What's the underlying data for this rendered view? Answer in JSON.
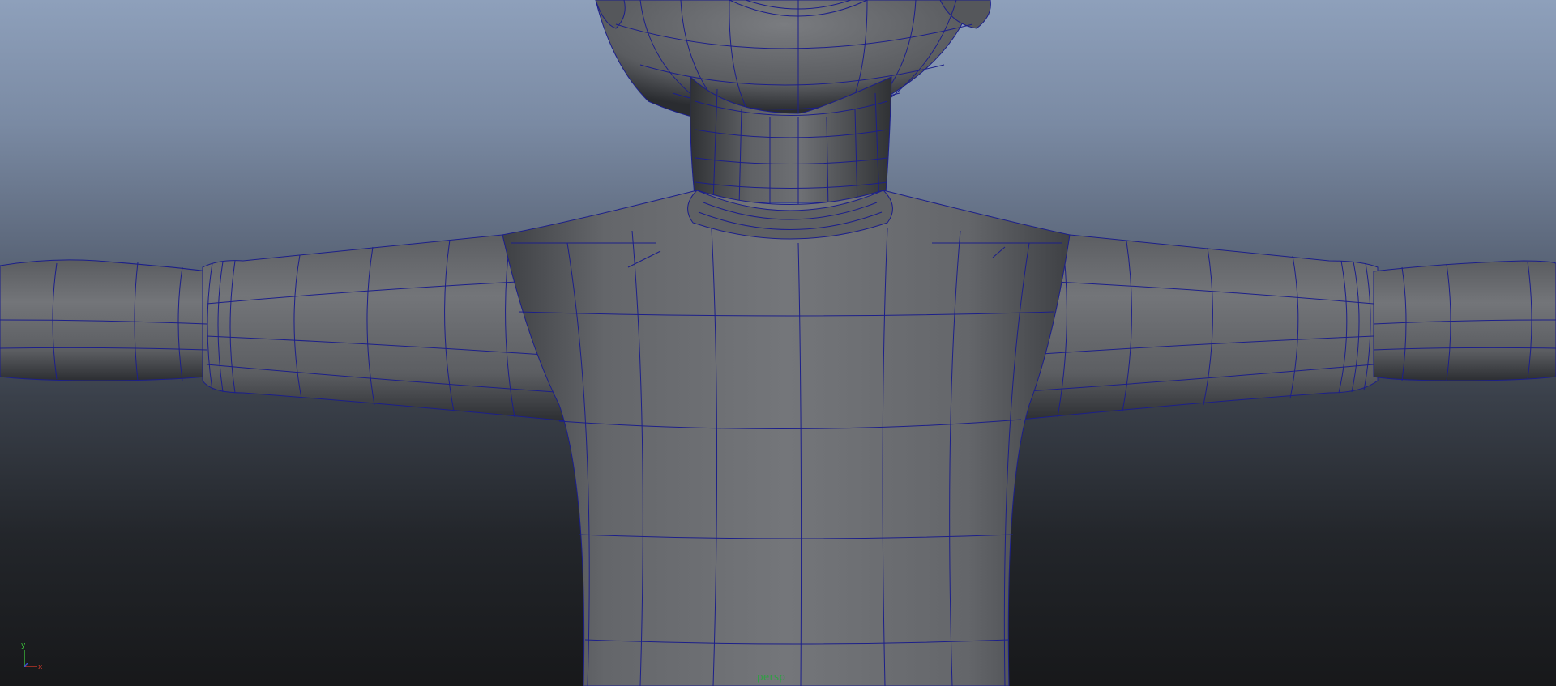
{
  "viewport": {
    "camera_name": "persp",
    "shading": "smooth-shade-with-wireframe",
    "background_gradient": {
      "top": "#8ea0bb",
      "bottom": "#17181a"
    },
    "wireframe_color": "#1c1f8a",
    "mesh_color": "#6d6f73",
    "model": "character-torso-t-pose"
  },
  "axis_gizmo": {
    "y_label": "y",
    "x_label": "x",
    "y_color": "#3cc43c",
    "x_color": "#d43a2a"
  }
}
